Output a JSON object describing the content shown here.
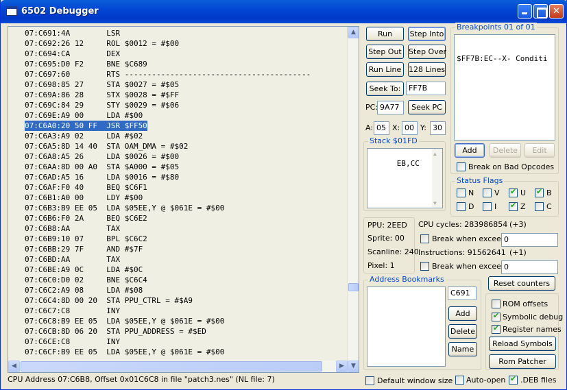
{
  "window": {
    "title": "6502 Debugger",
    "minimize_label": "",
    "maximize_label": "",
    "close_label": "✕"
  },
  "disassembly": {
    "lines": [
      "07:C691:4A        LSR",
      "07:C692:26 12     ROL $0012 = #$00",
      "07:C694:CA        DEX",
      "07:C695:D0 F2     BNE $C689",
      "07:C697:60        RTS -----------------------------------------",
      "07:C698:85 27     STA $0027 = #$05",
      "07:C69A:86 28     STX $0028 = #$FF",
      "07:C69C:84 29     STY $0029 = #$06",
      "07:C69E:A9 00     LDA #$00",
      "07:C6A0:20 50 FF  JSR $FF50",
      "07:C6A3:A9 02     LDA #$02",
      "07:C6A5:8D 14 40  STA OAM_DMA = #$02",
      "07:C6A8:A5 26     LDA $0026 = #$00",
      "07:C6AA:8D 00 A0  STA $A000 = #$05",
      "07:C6AD:A5 16     LDA $0016 = #$80",
      "07:C6AF:F0 40     BEQ $C6F1",
      "07:C6B1:A0 00     LDY #$00",
      "07:C6B3:B9 EE 05  LDA $05EE,Y @ $061E = #$00",
      "07:C6B6:F0 2A     BEQ $C6E2",
      "07:C6B8:AA        TAX",
      "07:C6B9:10 07     BPL $C6C2",
      "07:C6BB:29 7F     AND #$7F",
      "07:C6BD:AA        TAX",
      "07:C6BE:A9 0C     LDA #$0C",
      "07:C6C0:D0 02     BNE $C6C4",
      "07:C6C2:A9 08     LDA #$08",
      "07:C6C4:8D 00 20  STA PPU_CTRL = #$A9",
      "07:C6C7:C8        INY",
      "07:C6C8:B9 EE 05  LDA $05EE,Y @ $061E = #$00",
      "07:C6CB:8D 06 20  STA PPU_ADDRESS = #$ED",
      "07:C6CE:C8        INY",
      "07:C6CF:B9 EE 05  LDA $05EE,Y @ $061E = #$00"
    ],
    "selected_index": 9,
    "scroll_up": "▲",
    "scroll_down": "▼",
    "scroll_left": "◀",
    "scroll_right": "▶"
  },
  "status_bar": {
    "text": "CPU Address 07:C6B8, Offset 0x01C6C8 in file \"patch3.nes\" (NL file: 7)"
  },
  "controls": {
    "run": "Run",
    "step_into": "Step Into",
    "step_out": "Step Out",
    "step_over": "Step Over",
    "run_line": "Run Line",
    "lines_128": "128 Lines",
    "seek_to": "Seek To:",
    "seek_to_value": "FF7B",
    "pc_label": "PC:",
    "pc_value": "9A77",
    "seek_pc": "Seek PC",
    "a_label": "A:",
    "a_value": "05",
    "x_label": "X:",
    "x_value": "00",
    "y_label": "Y:",
    "y_value": "30"
  },
  "stack": {
    "title": "Stack $01FD",
    "contents": "EB,CC"
  },
  "breakpoints": {
    "title": "Breakpoints 01 of 01",
    "items": [
      "$FF7B:EC--X- Conditi"
    ],
    "add": "Add",
    "delete": "Delete",
    "edit": "Edit",
    "break_bad_opcodes": "Break on Bad Opcodes",
    "break_bad_opcodes_checked": false
  },
  "status_flags": {
    "title": "Status Flags",
    "flags": [
      {
        "name": "N",
        "checked": false
      },
      {
        "name": "V",
        "checked": false
      },
      {
        "name": "U",
        "checked": true
      },
      {
        "name": "B",
        "checked": true
      },
      {
        "name": "D",
        "checked": false
      },
      {
        "name": "I",
        "checked": false
      },
      {
        "name": "Z",
        "checked": true
      },
      {
        "name": "C",
        "checked": false
      }
    ]
  },
  "ppu": {
    "ppu": "PPU: 2EED",
    "sprite": "Sprite: 00",
    "scanline": "Scanline: 240",
    "pixel": "Pixel:  1"
  },
  "counters": {
    "cpu_cycles": "CPU cycles: 283986854",
    "cpu_cycles_delta": "(+3)",
    "break_exceed_1": "Break when exceed",
    "exceed_1_value": "0",
    "instructions": "Instructions: 91562641",
    "instructions_delta": "(+1)",
    "break_exceed_2": "Break when exceed",
    "exceed_2_value": "0",
    "reset": "Reset counters"
  },
  "bookmarks": {
    "title": "Address Bookmarks",
    "address_value": "C691",
    "add": "Add",
    "delete": "Delete",
    "name": "Name"
  },
  "options": {
    "rom_offsets": "ROM offsets",
    "rom_offsets_checked": false,
    "symbolic_debug": "Symbolic debug",
    "symbolic_debug_checked": true,
    "register_names": "Register names",
    "register_names_checked": true,
    "reload_symbols": "Reload Symbols",
    "rom_patcher": "Rom Patcher",
    "default_window_size": "Default window size",
    "default_window_size_checked": false,
    "auto_open": "Auto-open",
    "auto_open_checked": false,
    "deb_files": ".DEB files",
    "deb_files_checked": true
  }
}
